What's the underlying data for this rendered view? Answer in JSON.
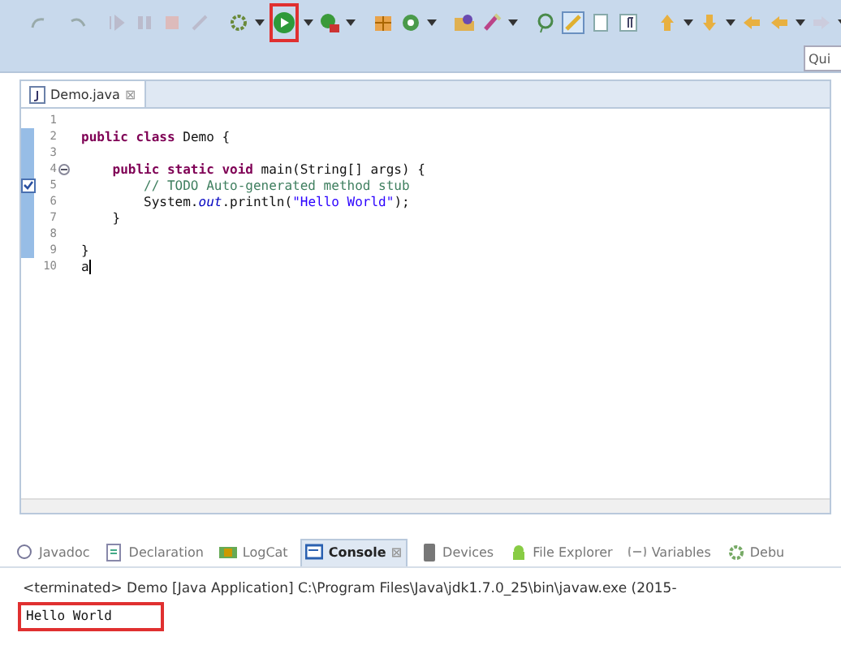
{
  "toolbar": {
    "run_button": {
      "highlighted": true
    },
    "quick_access": {
      "placeholder": "Qui"
    }
  },
  "editor": {
    "tab": {
      "label": "Demo.java",
      "close": "⊠"
    },
    "lines": [
      {
        "number": "1",
        "in_range": false,
        "fold_marker": false,
        "task_marker": false,
        "cursor": false
      },
      {
        "number": "2",
        "in_range": true,
        "fold_marker": false,
        "task_marker": false,
        "cursor": false,
        "segments": [
          {
            "kind": "keyword",
            "text": "public class "
          },
          {
            "kind": "plain",
            "text": "Demo {"
          }
        ]
      },
      {
        "number": "3",
        "in_range": true,
        "fold_marker": false,
        "task_marker": false,
        "cursor": false
      },
      {
        "number": "4",
        "in_range": true,
        "fold_marker": true,
        "task_marker": false,
        "cursor": false,
        "segments": [
          {
            "kind": "keyword",
            "text": "    public static void "
          },
          {
            "kind": "plain",
            "text": "main(String[] args) {"
          }
        ]
      },
      {
        "number": "5",
        "in_range": true,
        "fold_marker": false,
        "task_marker": true,
        "cursor": false,
        "segments": [
          {
            "kind": "comment",
            "text": "        // TODO Auto-generated method stub"
          }
        ]
      },
      {
        "number": "6",
        "in_range": true,
        "fold_marker": false,
        "task_marker": false,
        "cursor": false,
        "segments": [
          {
            "kind": "plain",
            "text": "        System."
          },
          {
            "kind": "field",
            "text": "out"
          },
          {
            "kind": "plain",
            "text": ".println("
          },
          {
            "kind": "string",
            "text": "\"Hello World\""
          },
          {
            "kind": "plain",
            "text": ");"
          }
        ]
      },
      {
        "number": "7",
        "in_range": true,
        "fold_marker": false,
        "task_marker": false,
        "cursor": false,
        "segments": [
          {
            "kind": "plain",
            "text": "    }"
          }
        ]
      },
      {
        "number": "8",
        "in_range": true,
        "fold_marker": false,
        "task_marker": false,
        "cursor": false
      },
      {
        "number": "9",
        "in_range": true,
        "fold_marker": false,
        "task_marker": false,
        "cursor": false,
        "segments": [
          {
            "kind": "plain",
            "text": "}"
          }
        ]
      },
      {
        "number": "10",
        "in_range": false,
        "fold_marker": false,
        "task_marker": false,
        "cursor": true,
        "segments": [
          {
            "kind": "plain",
            "text": "a"
          }
        ]
      }
    ]
  },
  "bottom_tabs": [
    {
      "label": "Javadoc",
      "selected": false
    },
    {
      "label": "Declaration",
      "selected": false
    },
    {
      "label": "LogCat",
      "selected": false
    },
    {
      "label": "Console",
      "selected": true,
      "close": "⊠"
    },
    {
      "label": "Devices",
      "selected": false
    },
    {
      "label": "File Explorer",
      "selected": false
    },
    {
      "label": "Variables",
      "selected": false
    },
    {
      "label": "Debu",
      "selected": false
    }
  ],
  "console": {
    "header": "<terminated> Demo [Java Application] C:\\Program Files\\Java\\jdk1.7.0_25\\bin\\javaw.exe (2015-",
    "output": "Hello World",
    "output_highlighted": true
  }
}
